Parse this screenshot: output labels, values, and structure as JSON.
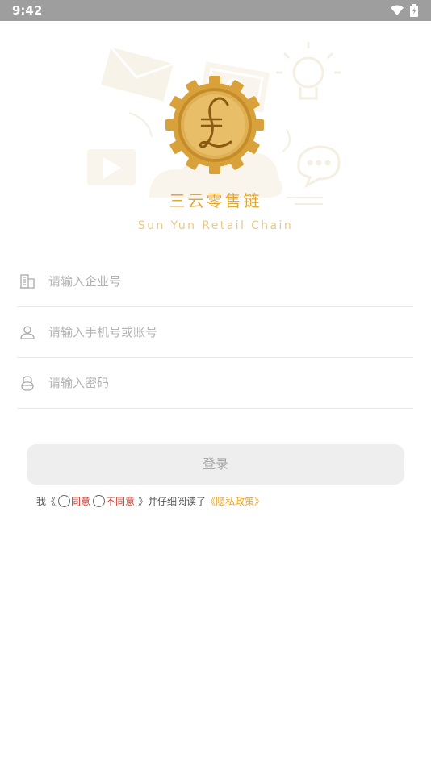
{
  "status_bar": {
    "time": "9:42"
  },
  "brand": {
    "name": "三云零售链",
    "subtitle": "Sun Yun Retail Chain"
  },
  "form": {
    "enterprise": {
      "placeholder": "请输入企业号",
      "icon": "building-icon"
    },
    "account": {
      "placeholder": "请输入手机号或账号",
      "icon": "user-icon"
    },
    "password": {
      "placeholder": "请输入密码",
      "icon": "lock-icon"
    }
  },
  "login_label": "登录",
  "agreement": {
    "prefix": "我《",
    "agree": "同意",
    "disagree": "不同意",
    "middle": "》并仔细阅读了",
    "policy_link": "《隐私政策》"
  },
  "colors": {
    "brand": "#e3a631",
    "status_bar": "#9e9e9e",
    "warning": "#d23a2a"
  }
}
